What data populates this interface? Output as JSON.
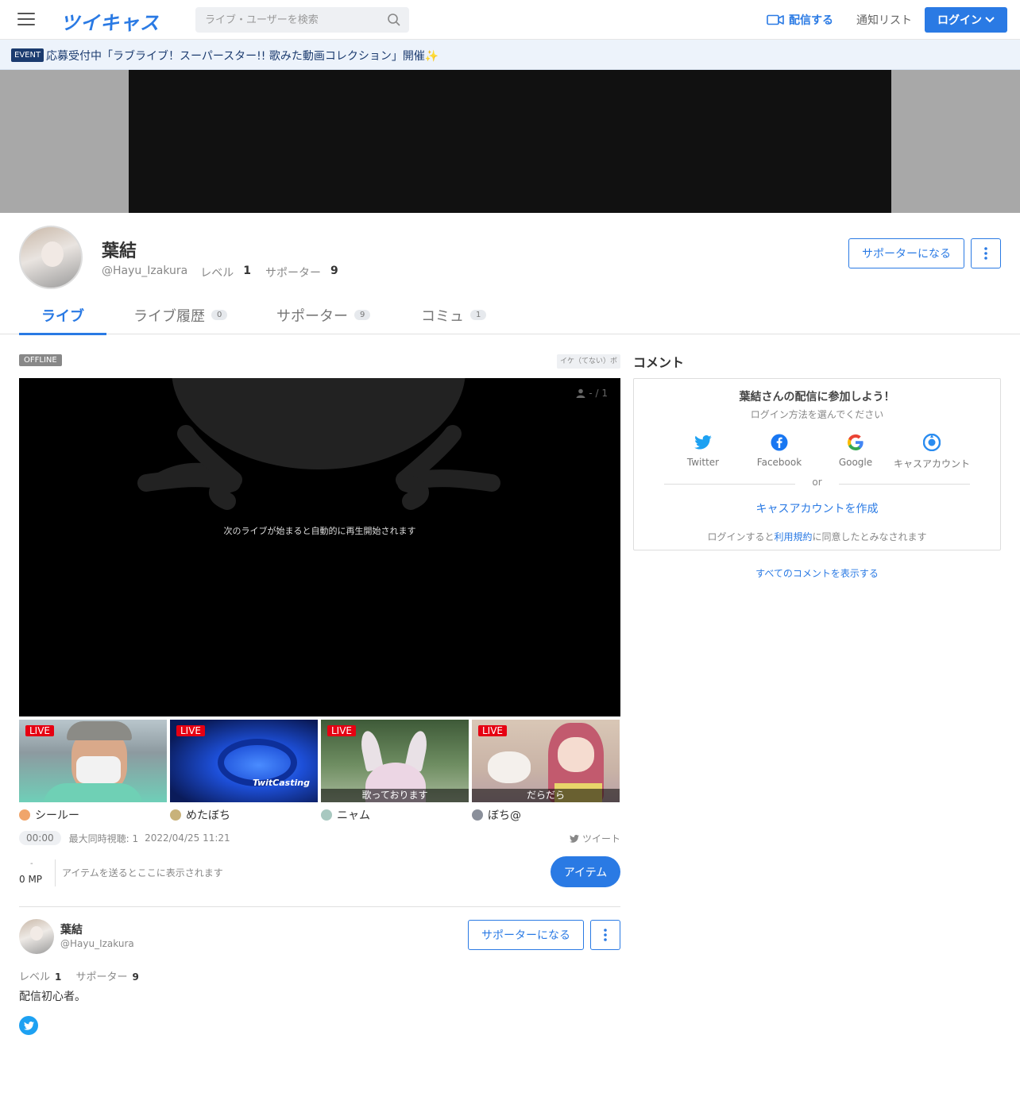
{
  "header": {
    "logo": "ツイキャス",
    "search_placeholder": "ライブ・ユーザーを検索",
    "broadcast_label": "配信する",
    "notify_label": "通知リスト",
    "login_label": "ログイン"
  },
  "event": {
    "badge": "EVENT",
    "text": "応募受付中「ラブライブ！スーパースター!! 歌みた動画コレクション」開催✨"
  },
  "profile": {
    "name": "葉結",
    "handle": "@Hayu_Izakura",
    "level_label": "レベル",
    "level": "1",
    "supporter_label": "サポーター",
    "supporters": "9",
    "support_button": "サポーターになる"
  },
  "tabs": [
    {
      "label": "ライブ",
      "count": ""
    },
    {
      "label": "ライブ履歴",
      "count": "0"
    },
    {
      "label": "サポーター",
      "count": "9"
    },
    {
      "label": "コミュ",
      "count": "1"
    }
  ],
  "player": {
    "status": "OFFLINE",
    "topic": "イケ（てない）ボ",
    "viewers": "- / 1",
    "message": "次のライブが始まると自動的に再生開始されます"
  },
  "live_thumbs": [
    {
      "badge": "LIVE",
      "caption": "",
      "user": "シールー",
      "color": "#6fcfb8"
    },
    {
      "badge": "LIVE",
      "caption": "",
      "user": "めたぼち",
      "color": "#1d4fd8"
    },
    {
      "badge": "LIVE",
      "caption": "歌っております",
      "user": "ニャム",
      "color": "#5b7a4e"
    },
    {
      "badge": "LIVE",
      "caption": "だらだら",
      "user": "ぼち@",
      "color": "#c9a6a0"
    }
  ],
  "stats": {
    "duration": "00:00",
    "max_viewers": "最大同時視聴: 1",
    "datetime": "2022/04/25 11:21",
    "tweet": "ツイート"
  },
  "items": {
    "mp_dash": "-",
    "mp_value": "0 MP",
    "info": "アイテムを送るとここに表示されます",
    "button": "アイテム"
  },
  "bio": {
    "name": "葉結",
    "handle": "@Hayu_Izakura",
    "support_button": "サポーターになる",
    "level_label": "レベル",
    "level": "1",
    "supporter_label": "サポーター",
    "supporters": "9",
    "text": "配信初心者。"
  },
  "comments": {
    "title": "コメント",
    "join_title": "葉結さんの配信に参加しよう！",
    "join_sub": "ログイン方法を選んでください",
    "providers": [
      "Twitter",
      "Facebook",
      "Google",
      "キャスアカウント"
    ],
    "or": "or",
    "create": "キャスアカウントを作成",
    "terms_pre": "ログインすると",
    "terms_link": "利用規約",
    "terms_post": "に同意したとみなされます",
    "show_all": "すべてのコメントを表示する"
  },
  "colors": {
    "accent": "#2a7ae4",
    "live": "#e60012",
    "twitter": "#1da1f2"
  }
}
